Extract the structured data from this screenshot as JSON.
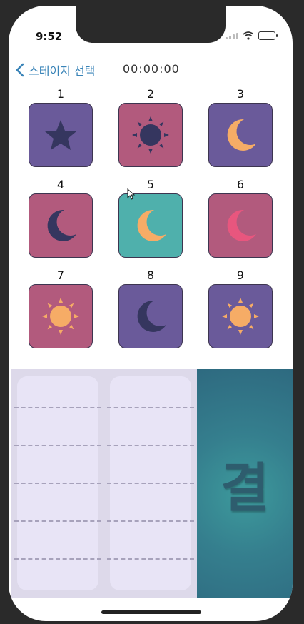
{
  "status": {
    "time": "9:52"
  },
  "navbar": {
    "back_label": "스테이지 선택",
    "timer": "00:00:00"
  },
  "stages": [
    {
      "number": "1",
      "icon": "star-icon",
      "bg": "#6a5a9a"
    },
    {
      "number": "2",
      "icon": "sun-icon",
      "bg": "#b25a7d"
    },
    {
      "number": "3",
      "icon": "moon-icon",
      "bg": "#6a5a9a"
    },
    {
      "number": "4",
      "icon": "moon-icon",
      "bg": "#b25a7d"
    },
    {
      "number": "5",
      "icon": "moon-icon",
      "bg": "#4fb0ac"
    },
    {
      "number": "6",
      "icon": "moon-icon",
      "bg": "#b25a7d"
    },
    {
      "number": "7",
      "icon": "sun-icon",
      "bg": "#b25a7d"
    },
    {
      "number": "8",
      "icon": "moon-icon",
      "bg": "#6a5a9a"
    },
    {
      "number": "9",
      "icon": "sun-icon",
      "bg": "#6a5a9a"
    }
  ],
  "result": {
    "char": "결"
  },
  "colors": {
    "accent": "#3a84b8",
    "navy": "#35365f",
    "orange": "#f6ac66",
    "pink": "#e8567e"
  }
}
